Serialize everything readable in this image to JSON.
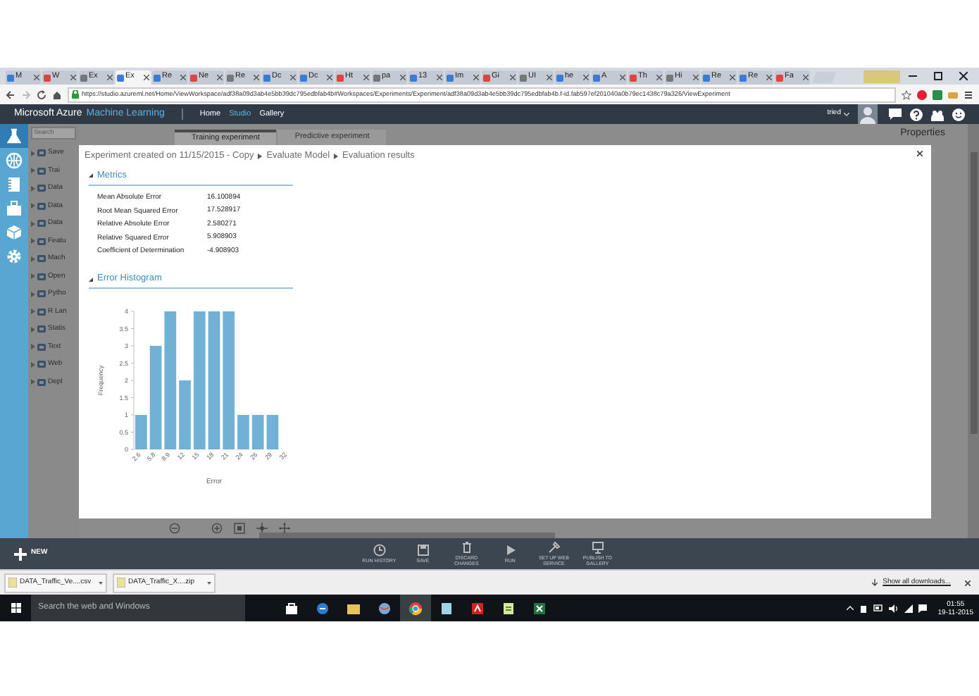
{
  "browser": {
    "tabs": [
      {
        "label": "M",
        "selected": false
      },
      {
        "label": "W",
        "selected": false
      },
      {
        "label": "Ex",
        "selected": false
      },
      {
        "label": "Ex",
        "selected": true
      },
      {
        "label": "Re",
        "selected": false
      },
      {
        "label": "Ne",
        "selected": false
      },
      {
        "label": "Re",
        "selected": false
      },
      {
        "label": "Dc",
        "selected": false
      },
      {
        "label": "Dc",
        "selected": false
      },
      {
        "label": "Ht",
        "selected": false
      },
      {
        "label": "pa",
        "selected": false
      },
      {
        "label": "13",
        "selected": false
      },
      {
        "label": "Im",
        "selected": false
      },
      {
        "label": "Gi",
        "selected": false
      },
      {
        "label": "UI",
        "selected": false
      },
      {
        "label": "he",
        "selected": false
      },
      {
        "label": "A",
        "selected": false
      },
      {
        "label": "Th",
        "selected": false
      },
      {
        "label": "Hi",
        "selected": false
      },
      {
        "label": "Re",
        "selected": false
      },
      {
        "label": "Re",
        "selected": false
      },
      {
        "label": "Fa",
        "selected": false
      }
    ],
    "url": "https://studio.azureml.net/Home/ViewWorkspace/adf38a09d3ab4e5bb39dc795edbfab4b#Workspaces/Experiments/Experiment/adf38a09d3ab4e5bb39dc795edbfab4b.f-id.fab597ef201040a0b79ec1438c79a326/ViewExperiment"
  },
  "header": {
    "brand": "Microsoft Azure",
    "product": "Machine Learning",
    "nav": [
      {
        "label": "Home",
        "selected": false
      },
      {
        "label": "Studio",
        "selected": true
      },
      {
        "label": "Gallery",
        "selected": false
      }
    ],
    "user": "tried"
  },
  "palette": {
    "search_placeholder": "Search",
    "items": [
      "Save",
      "Trai",
      "Data",
      "Data",
      "Data",
      "Featu",
      "Mach",
      "Open",
      "Pytho",
      "R Lan",
      "Statis",
      "Text",
      "Web",
      "Depl"
    ]
  },
  "canvas_tabs": [
    {
      "label": "Training experiment",
      "selected": true
    },
    {
      "label": "Predictive experiment",
      "selected": false
    }
  ],
  "properties": {
    "title": "Properties"
  },
  "dialog": {
    "breadcrumb": [
      "Experiment created on 11/15/2015 - Copy",
      "Evaluate Model",
      "Evaluation results"
    ],
    "sections": [
      {
        "kind": "metrics",
        "title": "Metrics",
        "expanded": true,
        "rows": [
          {
            "name": "Mean Absolute Error",
            "value": "16.100894"
          },
          {
            "name": "Root Mean Squared Error",
            "value": "17.528917"
          },
          {
            "name": "Relative Absolute Error",
            "value": "2.580271"
          },
          {
            "name": "Relative Squared Error",
            "value": "5.908903"
          },
          {
            "name": "Coefficient of Determination",
            "value": "-4.908903"
          }
        ]
      },
      {
        "kind": "chart",
        "title": "Error Histogram",
        "expanded": true,
        "chart_data": {
          "type": "bar",
          "xlabel": "Error",
          "ylabel": "Frequency",
          "categories": [
            "2.6",
            "5.8",
            "8.9",
            "12",
            "15",
            "18",
            "21",
            "24",
            "26",
            "29",
            "32"
          ],
          "series": [
            {
              "color": "#71b1d6",
              "values": [
                1,
                3,
                4,
                2,
                4,
                4,
                4,
                1,
                1,
                1,
                null
              ]
            }
          ],
          "ylim": [
            0,
            4
          ],
          "yticks": [
            0,
            0.5,
            1,
            1.5,
            2,
            2.5,
            3,
            3.5,
            4
          ]
        }
      }
    ]
  },
  "toolbar": {
    "new": "NEW",
    "actions": [
      "RUN HISTORY",
      "SAVE",
      "DISCARD CHANGES",
      "RUN",
      "SET UP WEB SERVICE",
      "PUBLISH TO GALLERY"
    ]
  },
  "downloads": {
    "files": [
      {
        "name": "DATA_Traffic_Ve....csv"
      },
      {
        "name": "DATA_Traffic_X....zip"
      }
    ],
    "show_all": "Show all downloads..."
  },
  "taskbar": {
    "search_placeholder": "Search the web and Windows",
    "time": "01:55",
    "date": "19-11-2015"
  }
}
